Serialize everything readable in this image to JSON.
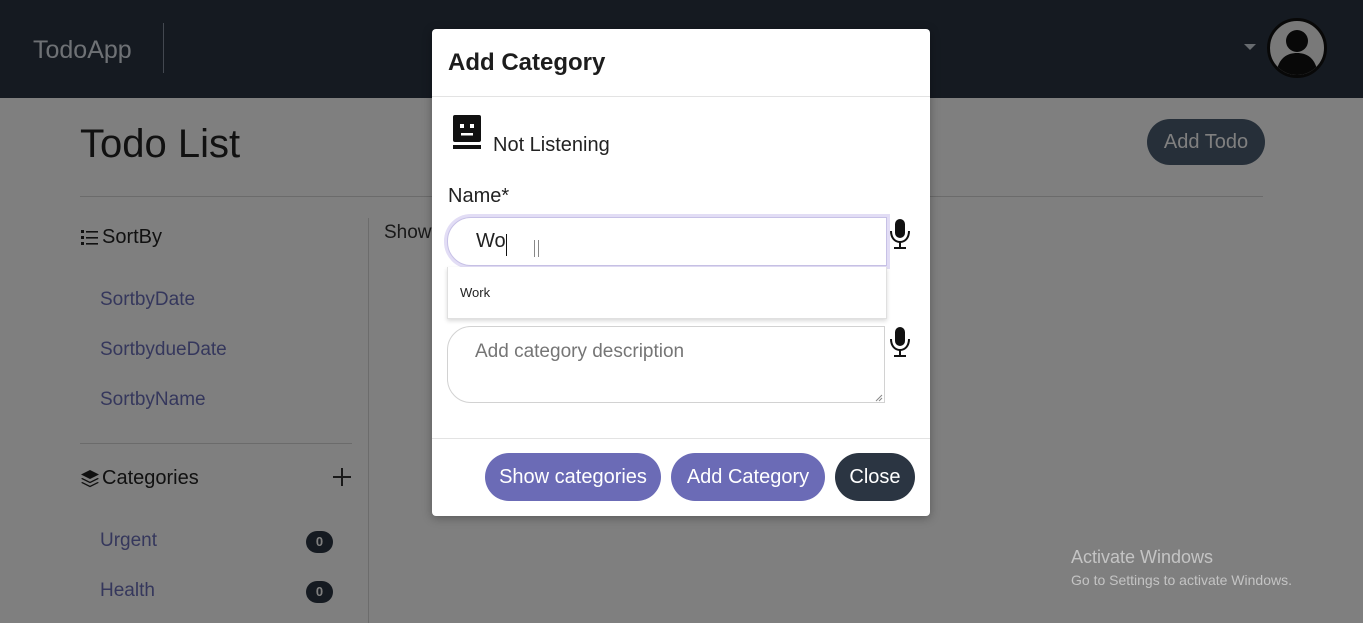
{
  "navbar": {
    "brand": "TodoApp"
  },
  "page": {
    "title": "Todo List",
    "add_todo_label": "Add Todo",
    "show_text": "Show"
  },
  "sidebar": {
    "sort_heading": "SortBy",
    "sort_items": [
      {
        "label": "SortbyDate"
      },
      {
        "label": "SortbydueDate"
      },
      {
        "label": "SortbyName"
      }
    ],
    "categories_heading": "Categories",
    "add_icon": "plus-icon",
    "categories": [
      {
        "label": "Urgent",
        "count": "0"
      },
      {
        "label": "Health",
        "count": "0"
      }
    ]
  },
  "modal": {
    "title": "Add Category",
    "status_icon": "robot-face-icon",
    "status_text": "Not Listening",
    "name_label": "Name*",
    "name_value": "Wo",
    "suggestions": [
      {
        "label": "Work"
      }
    ],
    "description_placeholder": "Add category description",
    "mic_icon": "microphone-icon",
    "buttons": {
      "show_categories": "Show categories",
      "add_category": "Add Category",
      "close": "Close"
    }
  },
  "watermark": {
    "title": "Activate Windows",
    "subtitle": "Go to Settings to activate Windows."
  },
  "colors": {
    "navbar": "#2b3542",
    "accent": "#6b6bb6",
    "link": "#6b6fb8",
    "badge": "#2b3542"
  }
}
